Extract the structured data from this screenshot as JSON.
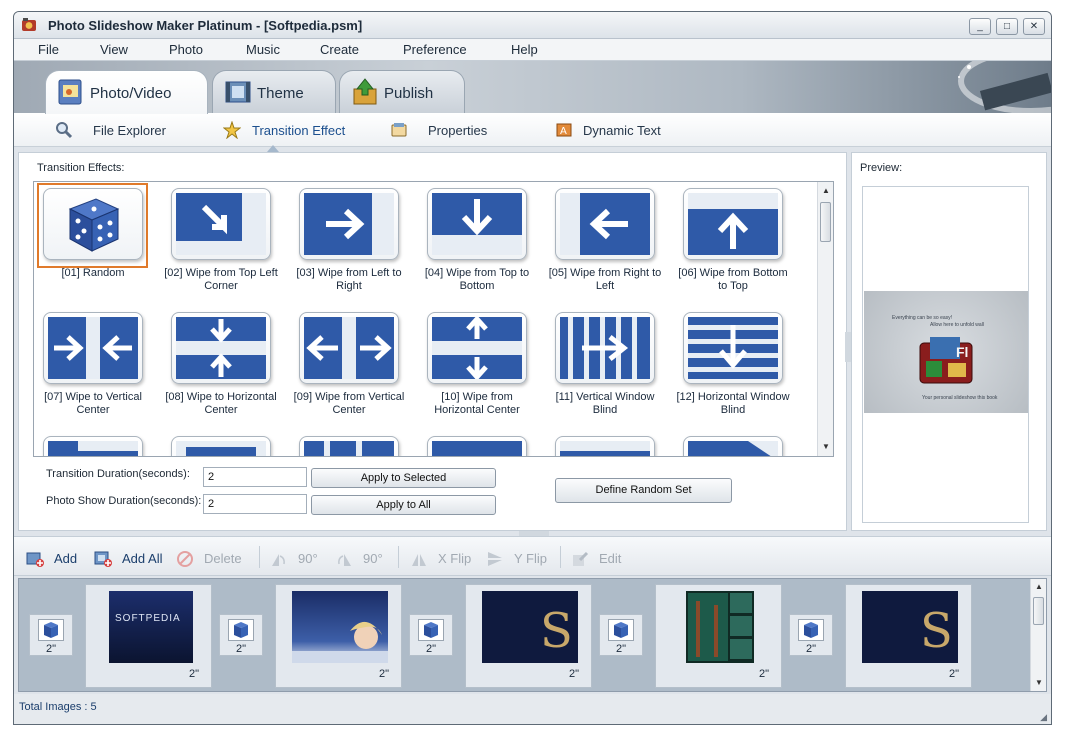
{
  "window": {
    "title": "Photo Slideshow Maker Platinum - [Softpedia.psm]",
    "controls": {
      "minimize": "_",
      "maximize": "□",
      "close": "✕"
    }
  },
  "menu": [
    "File",
    "View",
    "Photo",
    "Music",
    "Create",
    "Preference",
    "Help"
  ],
  "main_tabs": [
    {
      "label": "Photo/Video",
      "icon": "photo-video-icon",
      "active": true
    },
    {
      "label": "Theme",
      "icon": "theme-icon",
      "active": false
    },
    {
      "label": "Publish",
      "icon": "publish-icon",
      "active": false
    }
  ],
  "sub_tabs": [
    {
      "label": "File Explorer",
      "icon": "magnifier-icon",
      "active": false
    },
    {
      "label": "Transition Effect",
      "icon": "star-icon",
      "active": true
    },
    {
      "label": "Properties",
      "icon": "properties-icon",
      "active": false
    },
    {
      "label": "Dynamic Text",
      "icon": "dynamic-text-icon",
      "active": false
    }
  ],
  "transitions": {
    "heading": "Transition Effects:",
    "items": [
      {
        "label": "[01] Random",
        "icon": "dice-icon",
        "selected": true
      },
      {
        "label": "[02] Wipe from Top Left Corner",
        "icon": "arrow-down-right-icon"
      },
      {
        "label": "[03] Wipe from Left to Right",
        "icon": "arrow-right-icon"
      },
      {
        "label": "[04] Wipe from Top to Bottom",
        "icon": "arrow-down-icon"
      },
      {
        "label": "[05] Wipe from Right to Left",
        "icon": "arrow-left-icon"
      },
      {
        "label": "[06] Wipe from Bottom to Top",
        "icon": "arrow-up-icon"
      },
      {
        "label": "[07] Wipe to Vertical Center",
        "icon": "arrows-vertical-center-icon"
      },
      {
        "label": "[08] Wipe to Horizontal Center",
        "icon": "arrows-horizontal-center-icon"
      },
      {
        "label": "[09] Wipe from Vertical Center",
        "icon": "arrows-from-vertical-center-icon"
      },
      {
        "label": "[10] Wipe from Horizontal Center",
        "icon": "arrows-from-horizontal-center-icon"
      },
      {
        "label": "[11] Vertical Window Blind",
        "icon": "vertical-blind-icon"
      },
      {
        "label": "[12] Horizontal Window Blind",
        "icon": "horizontal-blind-icon"
      }
    ]
  },
  "durations": {
    "transition_label": "Transition Duration(seconds):",
    "transition_value": "2",
    "photo_label": "Photo Show Duration(seconds):",
    "photo_value": "2",
    "apply_selected": "Apply to Selected",
    "apply_all": "Apply to All",
    "define_random": "Define Random Set"
  },
  "preview": {
    "label": "Preview:",
    "caption_line1": "Everything can be so easy!",
    "caption_line2": "Allow here to unfold wall",
    "caption_line3": "Your personal slideshow this book"
  },
  "toolbar": {
    "add": "Add",
    "add_all": "Add All",
    "delete": "Delete",
    "rotate_left": "90°",
    "rotate_right": "90°",
    "x_flip": "X Flip",
    "y_flip": "Y Flip",
    "edit": "Edit"
  },
  "timeline": {
    "transition_duration": "2\"",
    "photo_duration": "2\"",
    "photos": [
      {
        "name": "softpedia-logo-photo",
        "text": "SOFTPEDIA"
      },
      {
        "name": "portrait-photo",
        "text": ""
      },
      {
        "name": "s-logo-photo",
        "text": ""
      },
      {
        "name": "forest-collage-photo",
        "text": ""
      },
      {
        "name": "s-logo-photo-2",
        "text": ""
      }
    ]
  },
  "status": {
    "total_images": "Total Images : 5"
  }
}
